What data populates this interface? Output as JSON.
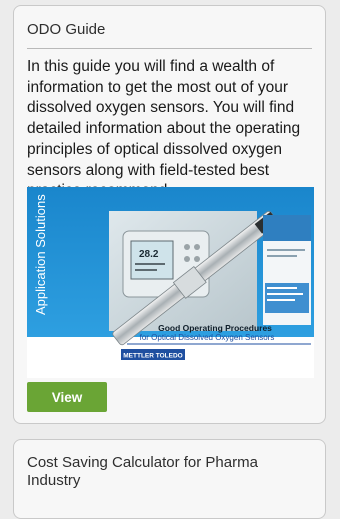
{
  "cards": [
    {
      "title": "ODO Guide",
      "description": "In this guide you will find a wealth of information to get the most out of your dissolved oxygen sensors. You will find detailed information about the operating principles of optical dissolved oxygen sensors along with field-tested best practice recommend",
      "cover": {
        "side_text": "Application Solutions",
        "display_reading": "28.2",
        "title_line1": "Good Operating Procedures",
        "title_line2": "for Optical Dissolved Oxygen Sensors",
        "brand": "METTLER TOLEDO"
      },
      "button_label": "View"
    },
    {
      "title": "Cost Saving Calculator for Pharma Industry"
    }
  ],
  "colors": {
    "accent": "#6aa535",
    "cover_blue": "#1c8fd4",
    "brand_blue": "#1f4fa0"
  }
}
